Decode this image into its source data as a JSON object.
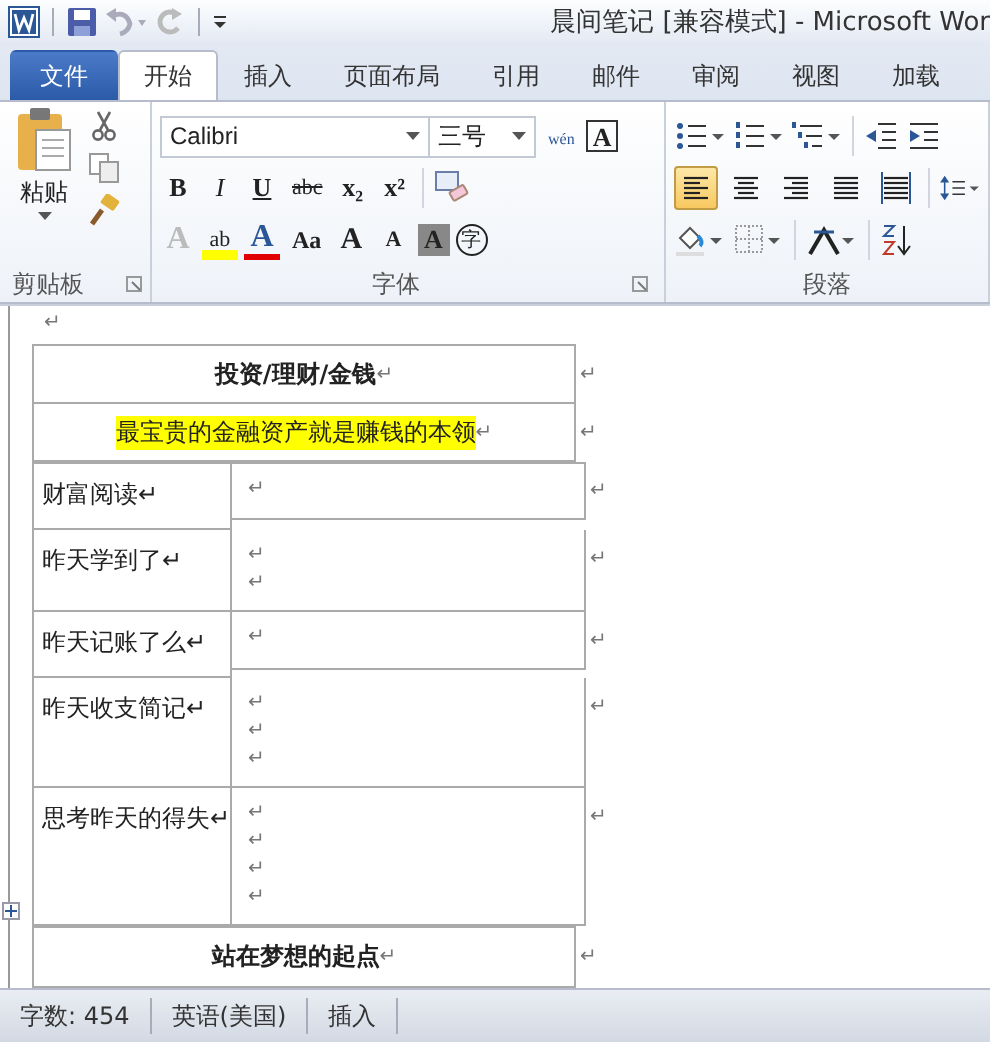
{
  "title_bar": {
    "title": "晨间笔记 [兼容模式]  -  Microsoft Wor"
  },
  "tabs": [
    {
      "label": "文件",
      "kind": "file",
      "selected": false
    },
    {
      "label": "开始",
      "kind": "tab",
      "selected": true
    },
    {
      "label": "插入",
      "kind": "tab",
      "selected": false
    },
    {
      "label": "页面布局",
      "kind": "tab",
      "selected": false
    },
    {
      "label": "引用",
      "kind": "tab",
      "selected": false
    },
    {
      "label": "邮件",
      "kind": "tab",
      "selected": false
    },
    {
      "label": "审阅",
      "kind": "tab",
      "selected": false
    },
    {
      "label": "视图",
      "kind": "tab",
      "selected": false
    },
    {
      "label": "加载",
      "kind": "tab",
      "selected": false
    }
  ],
  "clipboard": {
    "label": "剪贴板",
    "paste": "粘贴"
  },
  "font": {
    "label": "字体",
    "font_name": "Calibri",
    "font_size": "三号",
    "phonetic": "wén",
    "border_char": "A",
    "format_buttons": [
      {
        "text": "B",
        "kind": "bold"
      },
      {
        "text": "I",
        "kind": "italic"
      },
      {
        "text": "U",
        "kind": "underline"
      },
      {
        "text": "abc",
        "kind": "strike"
      },
      {
        "text": "x₂",
        "kind": "sub"
      },
      {
        "text": "x²",
        "kind": "sup"
      }
    ],
    "effect_buttons": [
      {
        "text": "A",
        "kind": "effect"
      },
      {
        "text": "ab",
        "kind": "highlight"
      },
      {
        "text": "A",
        "kind": "color"
      },
      {
        "text": "Aa",
        "kind": "case"
      },
      {
        "text": "A",
        "kind": "grow"
      },
      {
        "text": "A",
        "kind": "shrink"
      },
      {
        "text": "A",
        "kind": "shade"
      },
      {
        "text": "字",
        "kind": "enclose"
      }
    ]
  },
  "paragraph": {
    "label": "段落",
    "align": [
      {
        "kind": "left",
        "selected": true
      },
      {
        "kind": "center",
        "selected": false
      },
      {
        "kind": "right",
        "selected": false
      },
      {
        "kind": "justify",
        "selected": false
      },
      {
        "kind": "distributed",
        "selected": false
      }
    ]
  },
  "document": {
    "top_mark": "↵",
    "title_table": [
      {
        "text": "投资/理财/金钱",
        "mark": "↵",
        "highlight": false,
        "bold": true,
        "end": "↵"
      },
      {
        "text": "最宝贵的金融资产就是赚钱的本领",
        "mark": "↵",
        "highlight": true,
        "bold": false,
        "end": "↵"
      }
    ],
    "log_table": [
      {
        "label": "财富阅读↵",
        "lines": [
          "↵"
        ],
        "end": "↵"
      },
      {
        "label": "昨天学到了↵",
        "lines": [
          "↵",
          "↵"
        ],
        "end": "↵"
      },
      {
        "label": "昨天记账了么↵",
        "lines": [
          "↵"
        ],
        "end": "↵"
      },
      {
        "label": "昨天收支简记↵",
        "lines": [
          "↵",
          "↵",
          "↵"
        ],
        "end": "↵"
      },
      {
        "label": "思考昨天的得失↵",
        "lines": [
          "↵",
          "↵",
          "↵",
          "↵"
        ],
        "end": "↵"
      }
    ],
    "footer_table": [
      {
        "text": "站在梦想的起点",
        "mark": "↵",
        "highlight": false,
        "bold": true,
        "end": "↵"
      }
    ]
  },
  "status_bar": [
    "字数: 454",
    "英语(美国)",
    "插入"
  ]
}
